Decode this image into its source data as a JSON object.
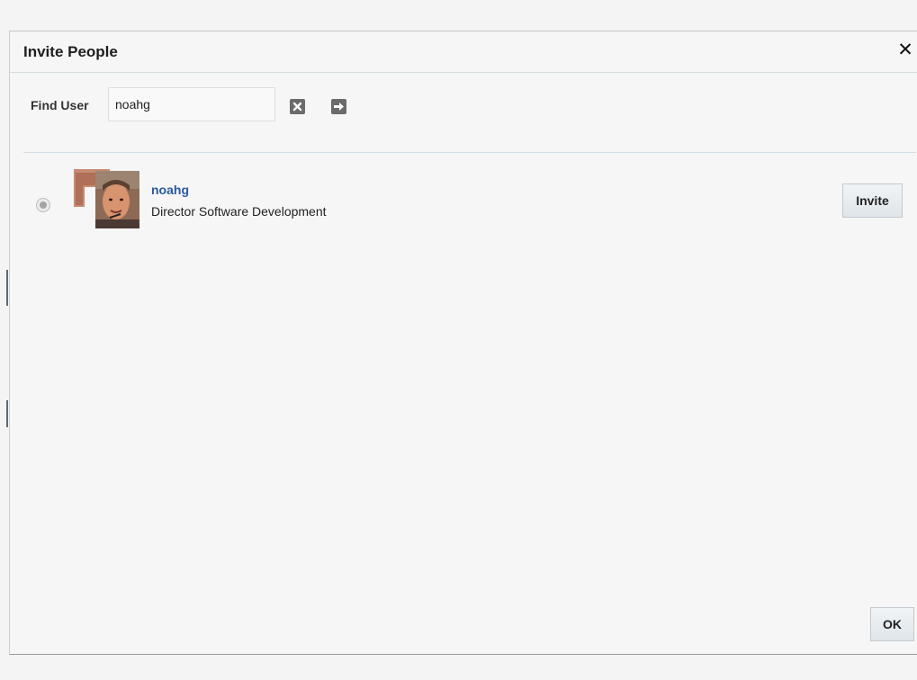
{
  "dialog": {
    "title": "Invite People",
    "close_icon": "close-icon"
  },
  "search": {
    "label": "Find User",
    "value": "noahg",
    "clear_icon": "clear-icon",
    "go_icon": "arrow-right-icon"
  },
  "results": [
    {
      "username": "noahg",
      "job_title": "Director Software Development",
      "selected": true,
      "invite_label": "Invite"
    }
  ],
  "footer": {
    "ok_label": "OK"
  }
}
